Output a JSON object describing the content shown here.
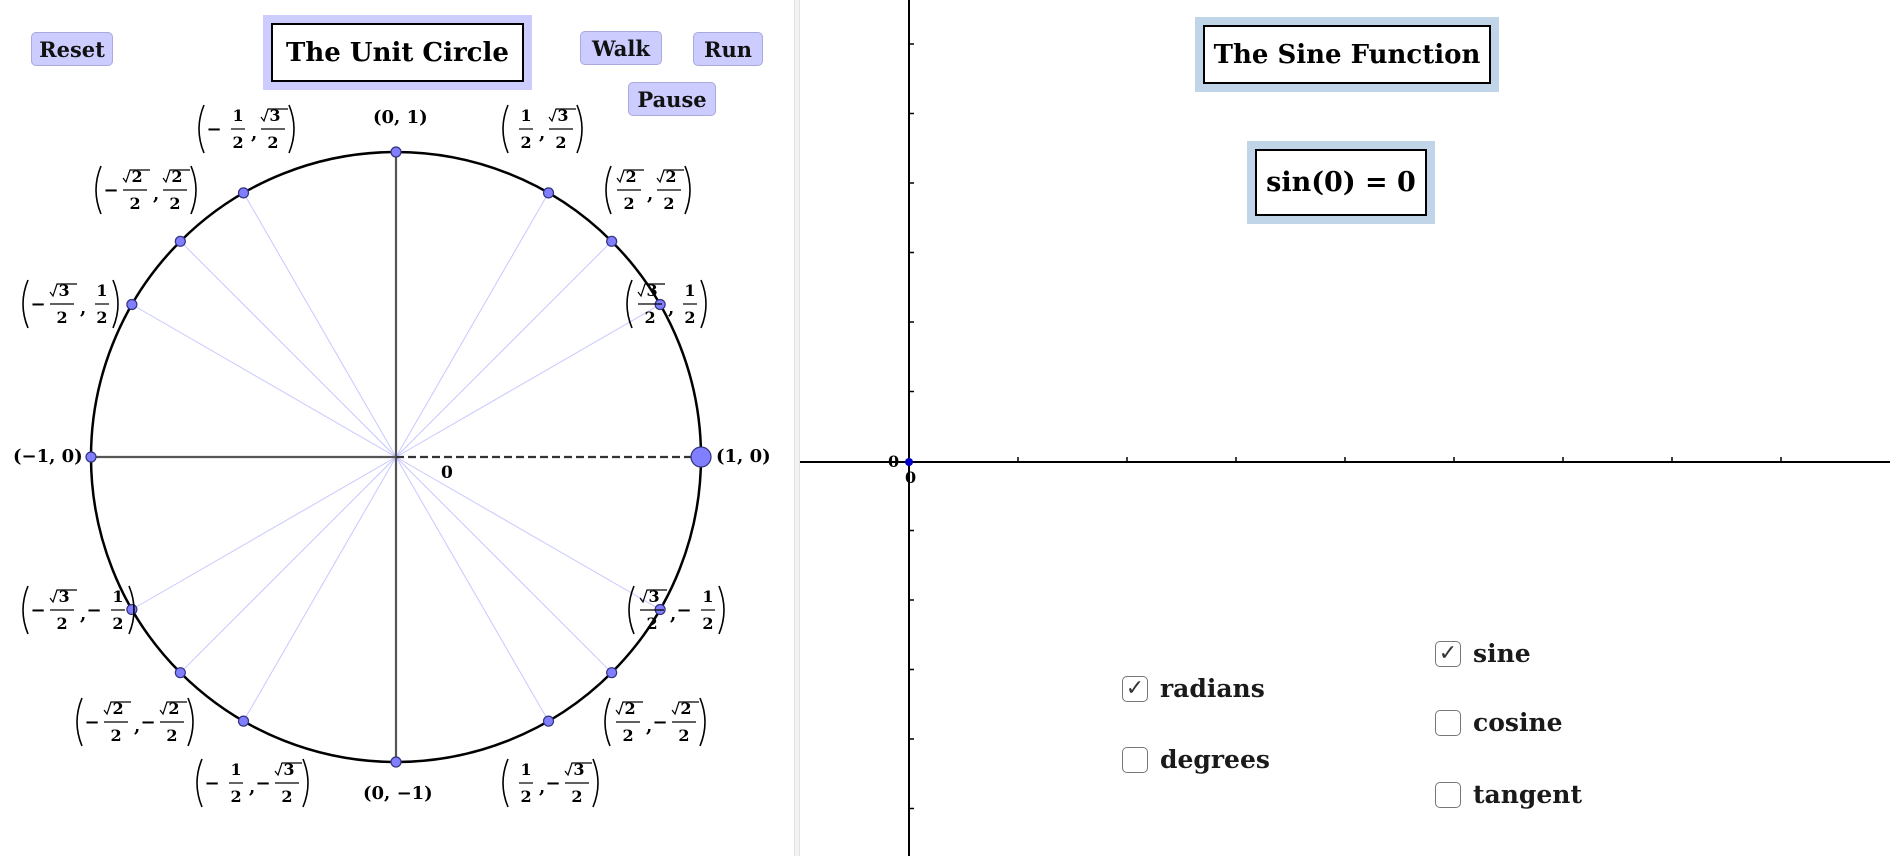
{
  "unit_circle": {
    "title": "The Unit Circle",
    "buttons": {
      "reset": "Reset",
      "walk": "Walk",
      "run": "Run",
      "pause": "Pause"
    },
    "angle_label": "0",
    "axis_labels": {
      "top": "(0, 1)",
      "bottom": "(0, −1)",
      "left": "(−1, 0)",
      "right": "(1, 0)"
    },
    "point_labels": [
      {
        "sign_x": "",
        "x": {
          "n": "√3",
          "d": "2"
        },
        "sign_y": "",
        "y": {
          "n": "1",
          "d": "2"
        }
      },
      {
        "sign_x": "",
        "x": {
          "n": "√2",
          "d": "2"
        },
        "sign_y": "",
        "y": {
          "n": "√2",
          "d": "2"
        }
      },
      {
        "sign_x": "",
        "x": {
          "n": "1",
          "d": "2"
        },
        "sign_y": "",
        "y": {
          "n": "√3",
          "d": "2"
        }
      },
      {
        "sign_x": "−",
        "x": {
          "n": "1",
          "d": "2"
        },
        "sign_y": "",
        "y": {
          "n": "√3",
          "d": "2"
        }
      },
      {
        "sign_x": "−",
        "x": {
          "n": "√2",
          "d": "2"
        },
        "sign_y": "",
        "y": {
          "n": "√2",
          "d": "2"
        }
      },
      {
        "sign_x": "−",
        "x": {
          "n": "√3",
          "d": "2"
        },
        "sign_y": "",
        "y": {
          "n": "1",
          "d": "2"
        }
      },
      {
        "sign_x": "−",
        "x": {
          "n": "√3",
          "d": "2"
        },
        "sign_y": "−",
        "y": {
          "n": "1",
          "d": "2"
        }
      },
      {
        "sign_x": "−",
        "x": {
          "n": "√2",
          "d": "2"
        },
        "sign_y": "−",
        "y": {
          "n": "√2",
          "d": "2"
        }
      },
      {
        "sign_x": "−",
        "x": {
          "n": "1",
          "d": "2"
        },
        "sign_y": "−",
        "y": {
          "n": "√3",
          "d": "2"
        }
      },
      {
        "sign_x": "",
        "x": {
          "n": "1",
          "d": "2"
        },
        "sign_y": "−",
        "y": {
          "n": "√3",
          "d": "2"
        }
      },
      {
        "sign_x": "",
        "x": {
          "n": "√2",
          "d": "2"
        },
        "sign_y": "−",
        "y": {
          "n": "√2",
          "d": "2"
        }
      },
      {
        "sign_x": "",
        "x": {
          "n": "√3",
          "d": "2"
        },
        "sign_y": "−",
        "y": {
          "n": "1",
          "d": "2"
        }
      }
    ]
  },
  "sine_function": {
    "title": "The Sine Function",
    "expression": "sin(0) = 0",
    "origin_x_label": "0",
    "origin_y_label": "0",
    "unit_options": [
      {
        "label": "radians",
        "checked": true
      },
      {
        "label": "degrees",
        "checked": false
      }
    ],
    "function_options": [
      {
        "label": "sine",
        "checked": true
      },
      {
        "label": "cosine",
        "checked": false
      },
      {
        "label": "tangent",
        "checked": false
      }
    ]
  },
  "colors": {
    "button_bg": "#ccccff",
    "point_fill": "#7f7fff",
    "title_frame_left": "#ccccff",
    "title_frame_right": "#c0d6e8",
    "spoke": "#c8c8ff"
  },
  "icons": {
    "checkbox_checked": "check-icon"
  }
}
